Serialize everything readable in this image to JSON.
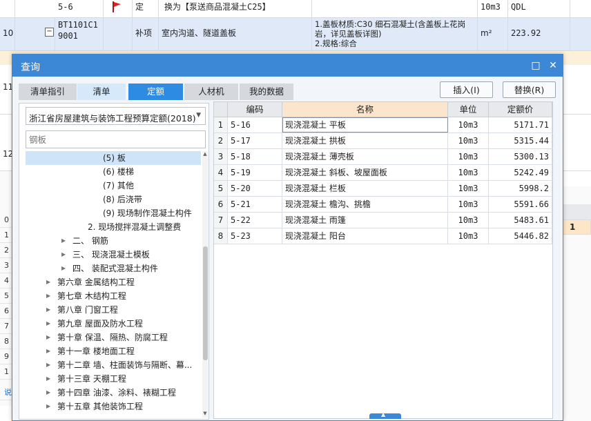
{
  "background": {
    "rows": [
      {
        "num": "",
        "code": "5-6",
        "flag": true,
        "type": "定",
        "name": "换为【泵送商品混凝土C25】",
        "feature": "",
        "unit": "10m3",
        "qty": "QDL"
      },
      {
        "num": "10",
        "code": "BT1101C19001",
        "type": "补项",
        "name": "室内沟道、隧道盖板",
        "feature": "1.盖板材质:C30 细石混凝土(含盖板上花岗岩，详见盖板详图)\n2.规格:综合",
        "unit": "m²",
        "qty": "223.92"
      },
      {
        "num": "11"
      },
      {
        "num": "12"
      }
    ],
    "left_numbers": [
      "0",
      "1",
      "2",
      "3",
      "4",
      "5",
      "6",
      "7",
      "8",
      "9",
      "1"
    ],
    "bottom_left_text": "说",
    "right_cell_number": "1"
  },
  "dialog": {
    "title": "查询",
    "maximize_icon": "□",
    "close_icon": "✕",
    "tabs": [
      {
        "label": "清单指引",
        "state": "normal"
      },
      {
        "label": "清单",
        "state": "light"
      },
      {
        "label": "定额",
        "state": "active"
      },
      {
        "label": "人材机",
        "state": "normal"
      },
      {
        "label": "我的数据",
        "state": "normal"
      }
    ],
    "insert_button": "插入(I)",
    "replace_button": "替换(R)",
    "quota_library": "浙江省房屋建筑与装饰工程预算定额(2018)",
    "search_placeholder": "钢板",
    "tree": [
      {
        "label": "(5) 板",
        "selected": true
      },
      {
        "label": "(6) 楼梯"
      },
      {
        "label": "(7) 其他"
      },
      {
        "label": "(8) 后浇带"
      },
      {
        "label": "(9) 现场制作混凝土构件"
      },
      {
        "label": "2. 现场搅拌混凝土调整费"
      },
      {
        "label": "二、 钢筋"
      },
      {
        "label": "三、 现浇混凝土模板"
      },
      {
        "label": "四、 装配式混凝土构件"
      },
      {
        "label": "第六章 金属结构工程"
      },
      {
        "label": "第七章 木结构工程"
      },
      {
        "label": "第八章 门窗工程"
      },
      {
        "label": "第九章 屋面及防水工程"
      },
      {
        "label": "第十章 保温、隔热、防腐工程"
      },
      {
        "label": "第十一章 楼地面工程"
      },
      {
        "label": "第十二章 墙、柱面装饰与隔断、幕..."
      },
      {
        "label": "第十三章 天棚工程"
      },
      {
        "label": "第十四章 油漆、涂料、裱糊工程"
      },
      {
        "label": "第十五章 其他装饰工程"
      }
    ],
    "grid": {
      "headers": {
        "code": "编码",
        "name": "名称",
        "unit": "单位",
        "price": "定额价"
      },
      "rows": [
        {
          "n": "1",
          "code": "5-16",
          "name": "现浇混凝土 平板",
          "unit": "10m3",
          "price": "5171.71"
        },
        {
          "n": "2",
          "code": "5-17",
          "name": "现浇混凝土 拱板",
          "unit": "10m3",
          "price": "5315.44"
        },
        {
          "n": "3",
          "code": "5-18",
          "name": "现浇混凝土 薄壳板",
          "unit": "10m3",
          "price": "5300.13"
        },
        {
          "n": "4",
          "code": "5-19",
          "name": "现浇混凝土 斜板、坡屋面板",
          "unit": "10m3",
          "price": "5242.49"
        },
        {
          "n": "5",
          "code": "5-20",
          "name": "现浇混凝土 栏板",
          "unit": "10m3",
          "price": "5998.2"
        },
        {
          "n": "6",
          "code": "5-21",
          "name": "现浇混凝土 檐沟、挑檐",
          "unit": "10m3",
          "price": "5591.66"
        },
        {
          "n": "7",
          "code": "5-22",
          "name": "现浇混凝土 雨篷",
          "unit": "10m3",
          "price": "5483.61"
        },
        {
          "n": "8",
          "code": "5-23",
          "name": "现浇混凝土 阳台",
          "unit": "10m3",
          "price": "5446.82"
        }
      ]
    }
  },
  "colors": {
    "title_bar": "#3c88d6",
    "active_tab": "#2d8be3",
    "header_accent": "#fbe5cc",
    "flag": "#e02020"
  }
}
